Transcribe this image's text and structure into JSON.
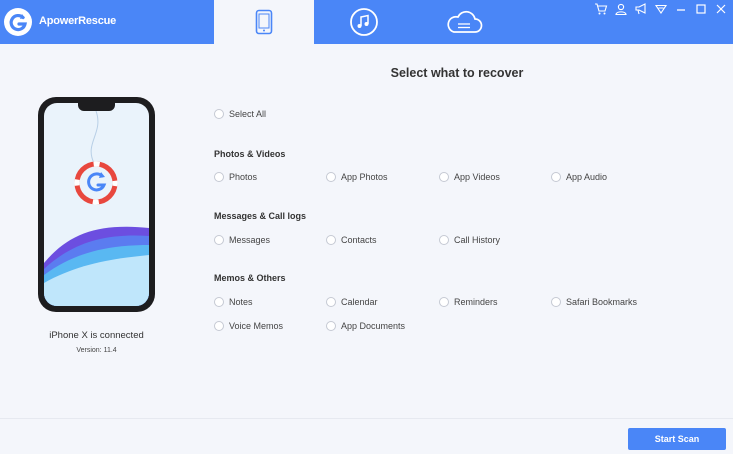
{
  "app": {
    "title": "ApowerRescue"
  },
  "header": {
    "tabs": [
      {
        "name": "recover-from-ios-device",
        "icon": "phone-icon",
        "active": true
      },
      {
        "name": "recover-from-itunes-backup",
        "icon": "music-icon",
        "active": false
      },
      {
        "name": "recover-from-icloud-backup",
        "icon": "cloud-icon",
        "active": false
      }
    ],
    "window_controls": [
      "cart-icon",
      "user-icon",
      "megaphone-icon",
      "dropdown-icon",
      "minimize-icon",
      "maximize-icon",
      "close-icon"
    ]
  },
  "device": {
    "status": "iPhone X is connected",
    "version": "Version: 11.4"
  },
  "main": {
    "title": "Select what to recover",
    "select_all": "Select All",
    "sections": [
      {
        "title": "Photos & Videos",
        "options": [
          "Photos",
          "App Photos",
          "App Videos",
          "App Audio"
        ]
      },
      {
        "title": "Messages & Call logs",
        "options": [
          "Messages",
          "Contacts",
          "Call History"
        ]
      },
      {
        "title": "Memos & Others",
        "options": [
          "Notes",
          "Calendar",
          "Reminders",
          "Safari Bookmarks",
          "Voice Memos",
          "App Documents"
        ]
      }
    ]
  },
  "footer": {
    "start_scan": "Start Scan"
  },
  "colors": {
    "accent": "#4a86f7",
    "background": "#f4f6fb",
    "logo_red": "#e8473e"
  }
}
